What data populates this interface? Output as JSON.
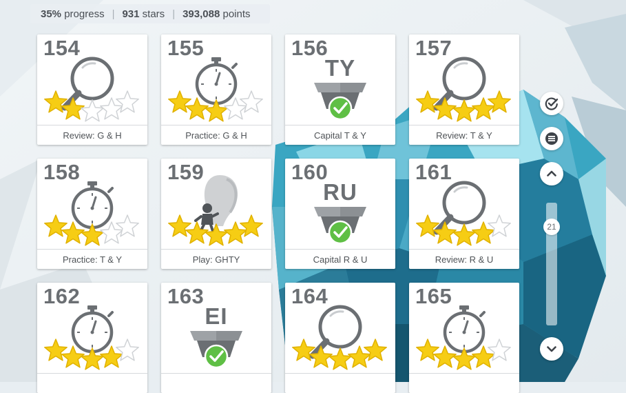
{
  "status": {
    "progress_value": "35%",
    "progress_label": "progress",
    "stars_value": "931",
    "stars_label": "stars",
    "points_value": "393,088",
    "points_label": "points",
    "separator": "|"
  },
  "lessons": [
    {
      "number": "154",
      "type": "review",
      "stars": 2,
      "label": "Review: G & H"
    },
    {
      "number": "155",
      "type": "practice",
      "stars": 3,
      "label": "Practice: G & H"
    },
    {
      "number": "156",
      "type": "capital",
      "letters": "TY",
      "label": "Capital T & Y",
      "completed": true
    },
    {
      "number": "157",
      "type": "review",
      "stars": 5,
      "label": "Review: T & Y"
    },
    {
      "number": "158",
      "type": "practice",
      "stars": 3,
      "label": "Practice: T & Y"
    },
    {
      "number": "159",
      "type": "play",
      "stars": 5,
      "label": "Play: GHTY"
    },
    {
      "number": "160",
      "type": "capital",
      "letters": "RU",
      "label": "Capital R & U",
      "completed": true
    },
    {
      "number": "161",
      "type": "review",
      "stars": 4,
      "label": "Review: R & U"
    },
    {
      "number": "162",
      "type": "practice",
      "stars": 4,
      "label": ""
    },
    {
      "number": "163",
      "type": "capital",
      "letters": "EI",
      "label": "",
      "completed": true
    },
    {
      "number": "164",
      "type": "review",
      "stars": 5,
      "label": ""
    },
    {
      "number": "165",
      "type": "practice",
      "stars": 4,
      "label": ""
    }
  ],
  "sidebar": {
    "check_icon": "check-circle-icon",
    "menu_icon": "hamburger-menu-icon",
    "up_icon": "chevron-up-icon",
    "down_icon": "chevron-down-icon",
    "scroll_position_label": "21"
  },
  "colors": {
    "star_fill": "#f6cd14",
    "card_icon": "#6b6f73",
    "check_green": "#5fbf45"
  }
}
